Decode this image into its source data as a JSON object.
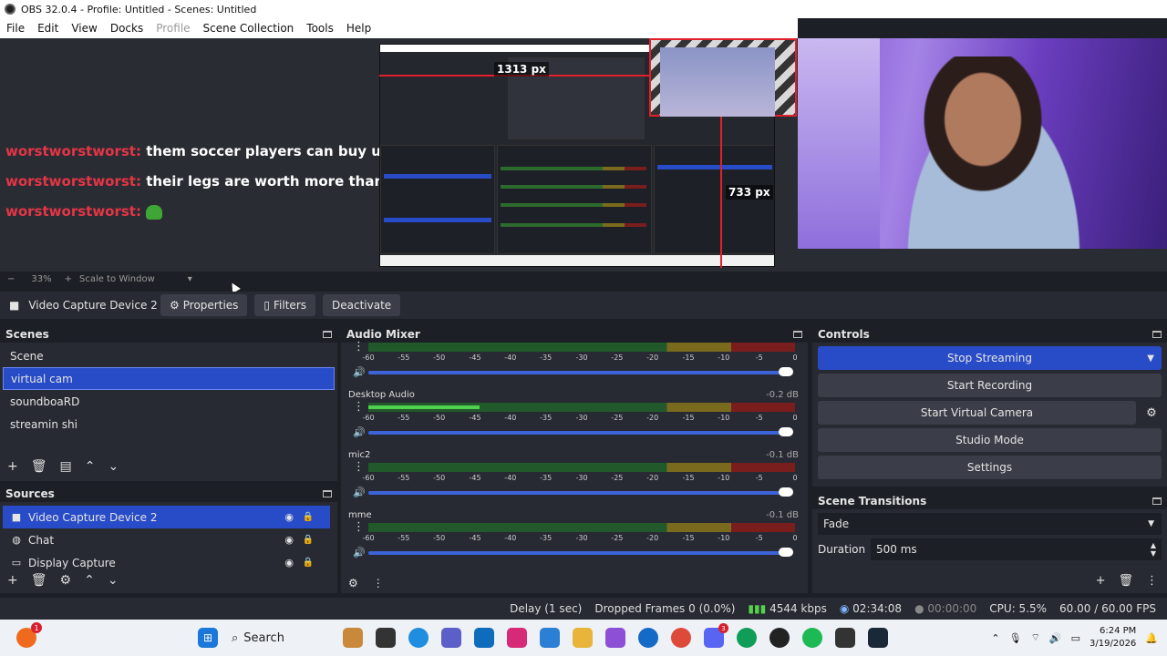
{
  "window": {
    "title": "OBS 32.0.4 - Profile: Untitled - Scenes: Untitled"
  },
  "menu": [
    "File",
    "Edit",
    "View",
    "Docks",
    "Profile",
    "Scene Collection",
    "Tools",
    "Help"
  ],
  "preview": {
    "chat": [
      {
        "user": "worstworstworst:",
        "msg": "them soccer players can buy ur family tree"
      },
      {
        "user": "worstworstworst:",
        "msg": "their legs are worth more than u"
      },
      {
        "user": "worstworstworst:",
        "msg": ""
      }
    ],
    "width_label": "1313 px",
    "height_label": "733 px"
  },
  "zoom": {
    "minus": "−",
    "percent": "33%",
    "plus": "+",
    "mode": "Scale to Window",
    "chev": "▾"
  },
  "source_toolbar": {
    "name": "Video Capture Device 2",
    "properties": "Properties",
    "filters": "Filters",
    "deactivate": "Deactivate"
  },
  "scenes": {
    "title": "Scenes",
    "items": [
      "Scene",
      "virtual cam",
      "soundboaRD",
      "streamin shi"
    ],
    "selected": 1
  },
  "sources": {
    "title": "Sources",
    "items": [
      {
        "name": "Video Capture Device 2",
        "icon": "camera-icon"
      },
      {
        "name": "Chat",
        "icon": "globe-icon"
      },
      {
        "name": "Display Capture",
        "icon": "monitor-icon"
      }
    ]
  },
  "mixer": {
    "title": "Audio Mixer",
    "scale": [
      "-60",
      "-55",
      "-50",
      "-45",
      "-40",
      "-35",
      "-30",
      "-25",
      "-20",
      "-15",
      "-10",
      "-5",
      "0"
    ],
    "channels": [
      {
        "name": "",
        "db": "",
        "level": 0
      },
      {
        "name": "Desktop Audio",
        "db": "-0.2 dB",
        "level": 0.26
      },
      {
        "name": "mic2",
        "db": "-0.1 dB",
        "level": 0
      },
      {
        "name": "mme",
        "db": "-0.1 dB",
        "level": 0
      }
    ]
  },
  "controls": {
    "title": "Controls",
    "stop_streaming": "Stop Streaming",
    "start_recording": "Start Recording",
    "start_virtual_camera": "Start Virtual Camera",
    "studio_mode": "Studio Mode",
    "settings": "Settings"
  },
  "transitions": {
    "title": "Scene Transitions",
    "selected": "Fade",
    "duration_label": "Duration",
    "duration_value": "500 ms"
  },
  "status": {
    "delay": "Delay (1 sec)",
    "dropped": "Dropped Frames 0 (0.0%)",
    "kbps": "4544 kbps",
    "stream_time": "02:34:08",
    "rec_time": "00:00:00",
    "cpu": "CPU: 5.5%",
    "fps": "60.00 / 60.00 FPS"
  },
  "taskbar": {
    "search": "Search",
    "time": "6:24 PM",
    "date": "3/19/2026",
    "badge": "1",
    "discord_badge": "3"
  },
  "colors": {
    "accent": "#284cc7",
    "chat_user": "#e43545",
    "meter_green": "#4fd14f"
  }
}
